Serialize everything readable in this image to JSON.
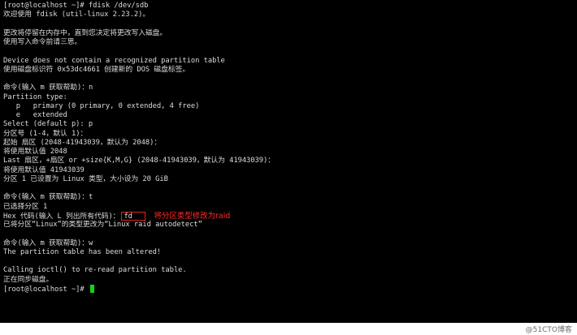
{
  "colors": {
    "background": "#000000",
    "text": "#dcdcdc",
    "highlight_box": "#e02020",
    "annotation": "#ff2a2a",
    "cursor": "#11d611"
  },
  "terminal": {
    "lines": [
      "[root@localhost ~]# fdisk /dev/sdb",
      "欢迎使用 fdisk (util-linux 2.23.2)。",
      "",
      "更改将停留在内存中，直到您决定将更改写入磁盘。",
      "使用写入命令前请三思。",
      "",
      "Device does not contain a recognized partition table",
      "使用磁盘标识符 0x53dc4661 创建新的 DOS 磁盘标签。",
      "",
      "命令(输入 m 获取帮助)：n",
      "Partition type:",
      "   p   primary (0 primary, 0 extended, 4 free)",
      "   e   extended",
      "Select (default p): p",
      "分区号 (1-4，默认 1)：",
      "起始 扇区 (2048-41943039，默认为 2048)：",
      "将使用默认值 2048",
      "Last 扇区，+扇区 or +size{K,M,G} (2048-41943039，默认为 41943039)：",
      "将使用默认值 41943039",
      "分区 1 已设置为 Linux 类型，大小设为 20 GiB",
      "",
      "命令(输入 m 获取帮助)：t",
      "已选择分区 1",
      "已将分区“Linux”的类型更改为“Linux raid autodetect”",
      "",
      "命令(输入 m 获取帮助)：w",
      "The partition table has been altered!",
      "",
      "Calling ioctl() to re-read partition table.",
      "正在同步磁盘。"
    ],
    "hex_prompt": "Hex 代码(输入 L 列出所有代码)：",
    "hex_value": "fd",
    "annotation": "将分区类型修改为raid",
    "final_prompt": "[root@localhost ~]# "
  },
  "watermark": "@51CTO博客"
}
